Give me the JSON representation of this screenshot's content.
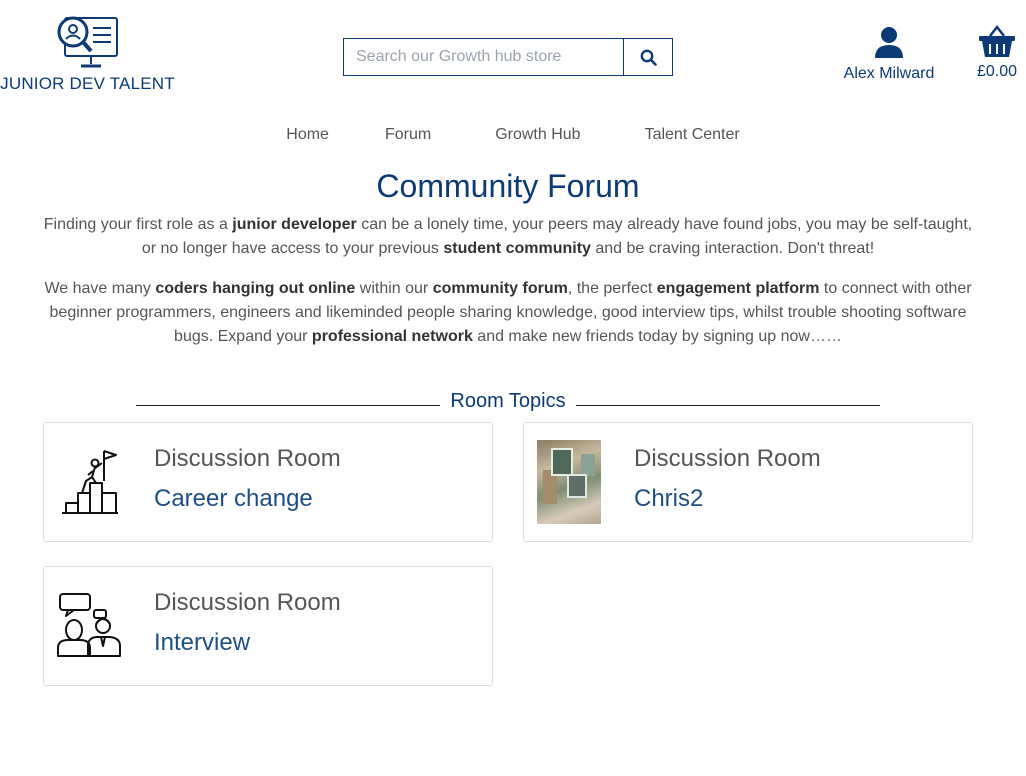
{
  "brand": {
    "name": "JUNIOR DEV TALENT"
  },
  "search": {
    "placeholder": "Search our Growth hub store",
    "icon": "search-icon"
  },
  "account": {
    "name": "Alex Milward",
    "icon": "user-icon"
  },
  "basket": {
    "total": "£0.00",
    "icon": "basket-icon"
  },
  "nav": {
    "items": [
      "Home",
      "Forum",
      "Growth Hub",
      "Talent Center"
    ]
  },
  "page": {
    "title": "Community Forum"
  },
  "intro": {
    "p1": [
      "Finding your first role as a ",
      "junior developer",
      " can be a lonely time, your peers may already have found jobs, you may be self-taught, or no longer have access to your previous ",
      "student community",
      " and be craving interaction. Don't threat!"
    ],
    "p2": [
      "We have many ",
      "coders hanging out online",
      " within our ",
      "community forum",
      ", the perfect ",
      "engagement platform",
      " to connect with other beginner programmers, engineers and likeminded people sharing knowledge, good interview tips, whilst trouble shooting software bugs. Expand your ",
      "professional network",
      " and make new friends today by signing up now……"
    ]
  },
  "section": {
    "title": "Room Topics"
  },
  "rooms": [
    {
      "kicker": "Discussion Room",
      "topic": "Career change",
      "icon": "career-climb-icon"
    },
    {
      "kicker": "Discussion Room",
      "topic": "Chris2",
      "icon": "room-photo"
    },
    {
      "kicker": "Discussion Room",
      "topic": "Interview",
      "icon": "interview-icon"
    }
  ],
  "colors": {
    "brand": "#0b3a75",
    "text": "#555555",
    "border": "#dddddd"
  }
}
